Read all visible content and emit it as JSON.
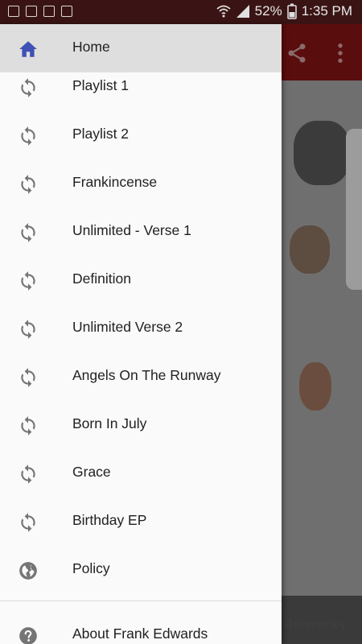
{
  "status_bar": {
    "battery": "52%",
    "time": "1:35 PM"
  },
  "background": {
    "footer_text": "d. Renmoney"
  },
  "drawer": {
    "items": [
      {
        "label": "Home",
        "icon": "home-icon"
      },
      {
        "label": "Playlist 1",
        "icon": "sync-icon"
      },
      {
        "label": "Playlist 2",
        "icon": "sync-icon"
      },
      {
        "label": "Frankincense",
        "icon": "sync-icon"
      },
      {
        "label": "Unlimited - Verse 1",
        "icon": "sync-icon"
      },
      {
        "label": "Definition",
        "icon": "sync-icon"
      },
      {
        "label": "Unlimited Verse 2",
        "icon": "sync-icon"
      },
      {
        "label": "Angels On The Runway",
        "icon": "sync-icon"
      },
      {
        "label": "Born In July",
        "icon": "sync-icon"
      },
      {
        "label": "Grace",
        "icon": "sync-icon"
      },
      {
        "label": "Birthday EP",
        "icon": "sync-icon"
      },
      {
        "label": "Policy",
        "icon": "globe-icon"
      }
    ],
    "footer_item": {
      "label": "About Frank Edwards",
      "icon": "help-icon"
    }
  },
  "colors": {
    "accent": "#3f51b5",
    "selected_bg": "#dedede",
    "toolbar": "#5a0d0d"
  }
}
